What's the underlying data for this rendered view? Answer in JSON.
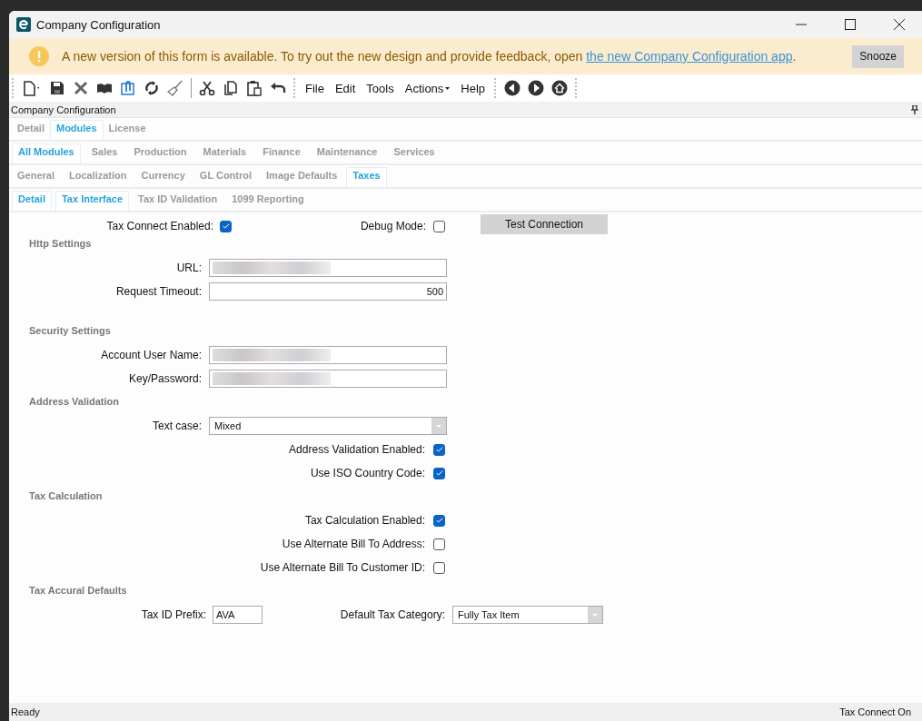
{
  "window": {
    "title": "Company Configuration"
  },
  "banner": {
    "message": "A new version of this form is available. To try out the new design and provide feedback, open ",
    "link": "the new Company Configuration app",
    "suffix": ".",
    "button": "Snooze"
  },
  "menus": [
    {
      "label": "File",
      "caret": false
    },
    {
      "label": "Edit",
      "caret": false
    },
    {
      "label": "Tools",
      "caret": false
    },
    {
      "label": "Actions",
      "caret": true
    },
    {
      "label": "Help",
      "caret": false
    }
  ],
  "panel_title": "Company Configuration",
  "tab_rows": [
    [
      {
        "label": "Detail",
        "selected": false
      },
      {
        "label": "Modules",
        "selected": true
      },
      {
        "label": "License",
        "selected": false
      }
    ],
    [
      {
        "label": "All Modules",
        "selected": true
      },
      {
        "label": "Sales",
        "selected": false
      },
      {
        "label": "Production",
        "selected": false
      },
      {
        "label": "Materials",
        "selected": false
      },
      {
        "label": "Finance",
        "selected": false
      },
      {
        "label": "Maintenance",
        "selected": false
      },
      {
        "label": "Services",
        "selected": false
      }
    ],
    [
      {
        "label": "General",
        "selected": false
      },
      {
        "label": "Localization",
        "selected": false
      },
      {
        "label": "Currency",
        "selected": false
      },
      {
        "label": "GL Control",
        "selected": false
      },
      {
        "label": "Image Defaults",
        "selected": false
      },
      {
        "label": "Taxes",
        "selected": true
      }
    ],
    [
      {
        "label": "Detail",
        "selected": true
      },
      {
        "label": "Tax Interface",
        "selected": true
      },
      {
        "label": "Tax ID Validation",
        "selected": false
      },
      {
        "label": "1099 Reporting",
        "selected": false
      }
    ]
  ],
  "sections": [
    {
      "rows": [
        {
          "kind": "inline",
          "items": [
            {
              "kind": "check",
              "label": "Tax Connect Enabled:",
              "checked": true
            },
            {
              "kind": "check",
              "label": "Debug Mode:",
              "checked": false
            },
            {
              "kind": "button",
              "label": "Test Connection"
            }
          ]
        }
      ]
    },
    {
      "title": "Http Settings",
      "rows": [
        {
          "kind": "redacted",
          "label": "URL:"
        },
        {
          "kind": "text",
          "label": "Request Timeout:",
          "value": "500"
        }
      ]
    },
    {
      "title": "Security Settings",
      "rows": [
        {
          "kind": "redacted",
          "label": "Account User Name:"
        },
        {
          "kind": "redacted",
          "label": "Key/Password:"
        }
      ]
    },
    {
      "title": "Address Validation",
      "rows": [
        {
          "kind": "select",
          "label": "Text case:",
          "value": "Mixed"
        },
        {
          "kind": "check",
          "label": "Address Validation Enabled:",
          "checked": true
        },
        {
          "kind": "check",
          "label": "Use ISO Country Code:",
          "checked": true
        }
      ]
    },
    {
      "title": "Tax Calculation",
      "rows": [
        {
          "kind": "check",
          "label": "Tax Calculation Enabled:",
          "checked": true
        },
        {
          "kind": "check",
          "label": "Use Alternate Bill To Address:",
          "checked": false
        },
        {
          "kind": "check",
          "label": "Use Alternate Bill To Customer ID:",
          "checked": false
        }
      ]
    },
    {
      "title": "Tax Accural Defaults",
      "rows": [
        {
          "kind": "inline",
          "items": [
            {
              "kind": "text",
              "label": "Tax ID Prefix:",
              "value": "AVA"
            },
            {
              "kind": "select",
              "label": "Default Tax Category:",
              "value": "Fully Tax Item"
            }
          ]
        }
      ]
    }
  ],
  "status_bar": {
    "left": "Ready",
    "right": "Tax Connect On"
  }
}
